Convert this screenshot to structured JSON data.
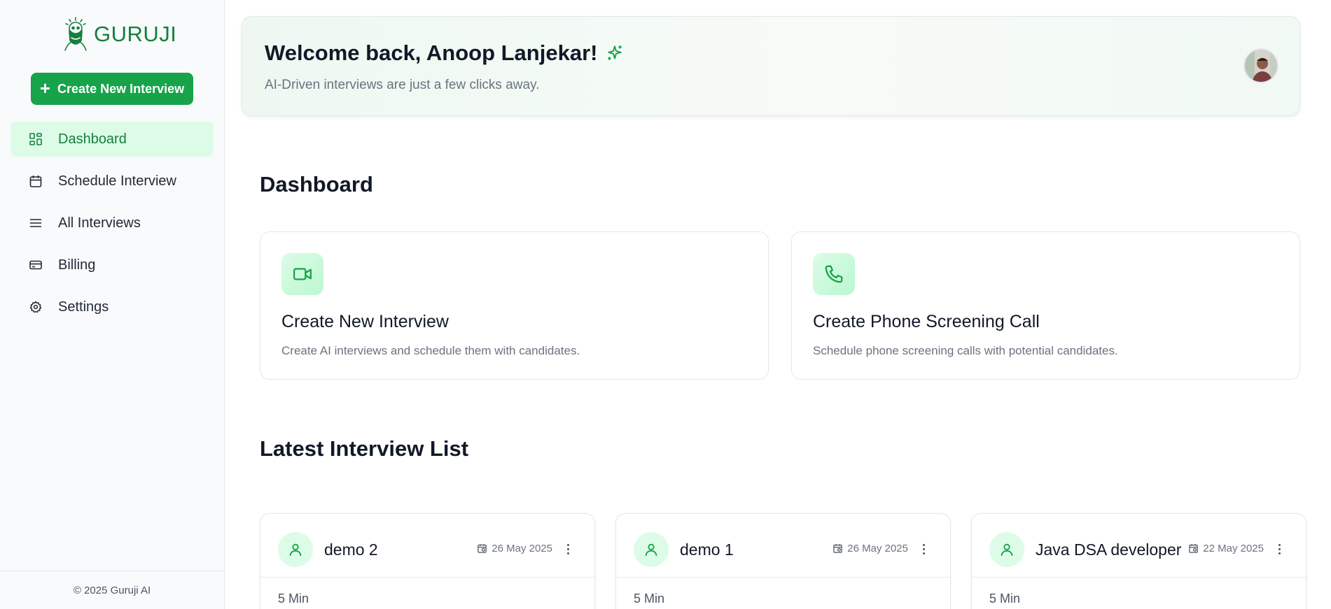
{
  "brand": {
    "name": "GURUJI"
  },
  "sidebar": {
    "create_button": "Create New Interview",
    "items": [
      {
        "label": "Dashboard",
        "icon": "layout-grid-icon",
        "active": true
      },
      {
        "label": "Schedule Interview",
        "icon": "calendar-icon",
        "active": false
      },
      {
        "label": "All Interviews",
        "icon": "list-icon",
        "active": false
      },
      {
        "label": "Billing",
        "icon": "credit-card-icon",
        "active": false
      },
      {
        "label": "Settings",
        "icon": "gear-icon",
        "active": false
      }
    ],
    "footer": "© 2025 Guruji AI"
  },
  "welcome": {
    "title": "Welcome back, Anoop Lanjekar!",
    "subtitle": "AI-Driven interviews are just a few clicks away."
  },
  "dashboard": {
    "title": "Dashboard",
    "cards": [
      {
        "title": "Create New Interview",
        "description": "Create AI interviews and schedule them with candidates.",
        "icon": "video-camera-icon"
      },
      {
        "title": "Create Phone Screening Call",
        "description": "Schedule phone screening calls with potential candidates.",
        "icon": "phone-icon"
      }
    ]
  },
  "latest": {
    "title": "Latest Interview List",
    "interviews": [
      {
        "name": "demo 2",
        "date": "26 May 2025",
        "duration": "5 Min"
      },
      {
        "name": "demo 1",
        "date": "26 May 2025",
        "duration": "5 Min"
      },
      {
        "name": "Java DSA developer",
        "date": "22 May 2025",
        "duration": "5 Min"
      }
    ]
  },
  "colors": {
    "accent": "#16a34a",
    "accent_dark": "#15803d",
    "accent_light": "#dcfce7"
  }
}
